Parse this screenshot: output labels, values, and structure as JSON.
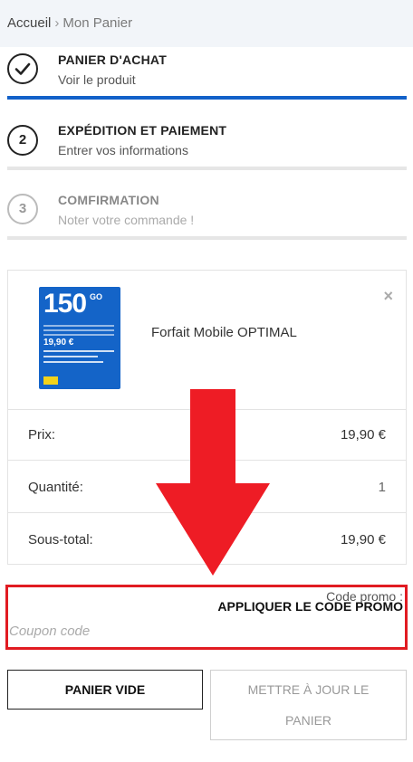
{
  "breadcrumb": {
    "home": "Accueil",
    "separator": "›",
    "current": "Mon Panier"
  },
  "steps": [
    {
      "number": "",
      "icon": "check-icon",
      "title": "PANIER D'ACHAT",
      "subtitle": "Voir le produit",
      "state": "done"
    },
    {
      "number": "2",
      "title": "EXPÉDITION ET PAIEMENT",
      "subtitle": "Entrer vos informations",
      "state": "active"
    },
    {
      "number": "3",
      "title": "COMFIRMATION",
      "subtitle": "Noter votre commande !",
      "state": "inactive"
    }
  ],
  "product": {
    "name": "Forfait Mobile OPTIMAL",
    "image": {
      "big_text": "150",
      "unit": "GO",
      "price_text": "19,90 €"
    },
    "remove_icon": "close-icon"
  },
  "summary": {
    "price_label": "Prix:",
    "price_value": "19,90 €",
    "qty_label": "Quantité:",
    "qty_value": "1",
    "subtotal_label": "Sous-total:",
    "subtotal_value": "19,90 €"
  },
  "coupon": {
    "label": "Code promo :",
    "apply_label": "APPLIQUER LE CODE PROMO",
    "placeholder": "Coupon code"
  },
  "actions": {
    "empty_cart": "PANIER VIDE",
    "update_cart": "METTRE À JOUR LE PANIER"
  },
  "colors": {
    "accent": "#1261c9",
    "highlight": "#e11b22",
    "arrow": "#ee1c25"
  }
}
